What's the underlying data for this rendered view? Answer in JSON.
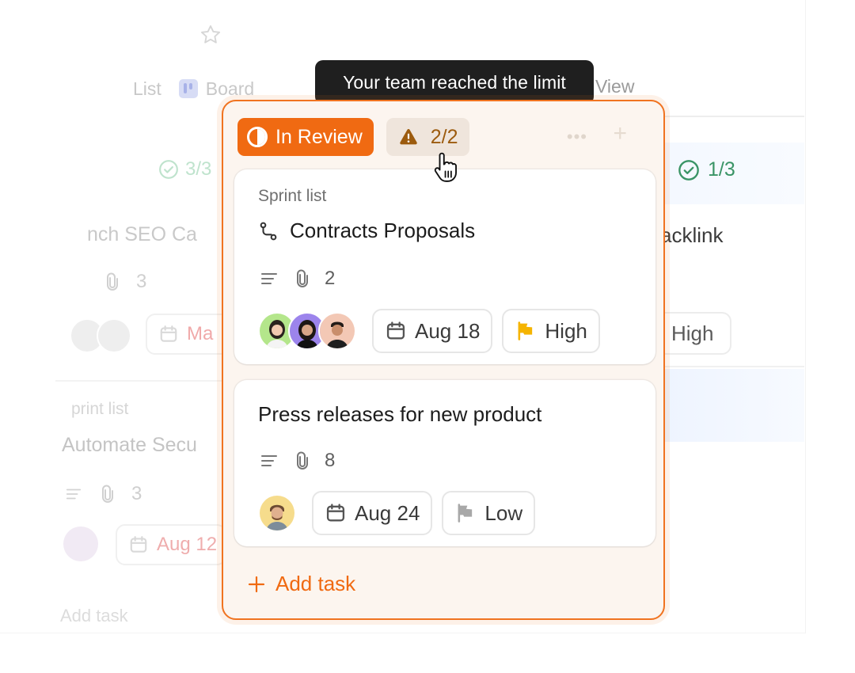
{
  "background": {
    "tabs": {
      "list": "List",
      "board": "Board",
      "view": "View"
    },
    "left_column": {
      "count": "3/3",
      "card1": {
        "title": "nch SEO Ca",
        "attachments": "3",
        "date": "Ma"
      },
      "card2": {
        "list": "print list",
        "title": "Automate Secu",
        "attachments": "3",
        "date": "Aug 12"
      },
      "add_task": "Add task"
    },
    "right_column": {
      "count": "1/3",
      "title": "acklink",
      "priority": "High"
    }
  },
  "tooltip": {
    "text": "Your team reached the limit"
  },
  "column": {
    "status_label": "In Review",
    "limit_count": "2/2",
    "cards": [
      {
        "list": "Sprint list",
        "title": "Contracts Proposals",
        "attachments": "2",
        "date": "Aug 18",
        "priority": "High",
        "priority_color": "#f5b400"
      },
      {
        "title": "Press releases for new product",
        "attachments": "8",
        "date": "Aug 24",
        "priority": "Low",
        "priority_color": "#a8a8a8"
      }
    ],
    "add_task": "Add task"
  },
  "colors": {
    "accent": "#f06a12",
    "limit_text": "#9c5b0e",
    "done_green": "#3a9466",
    "tooltip_bg": "#1f1f1f"
  }
}
